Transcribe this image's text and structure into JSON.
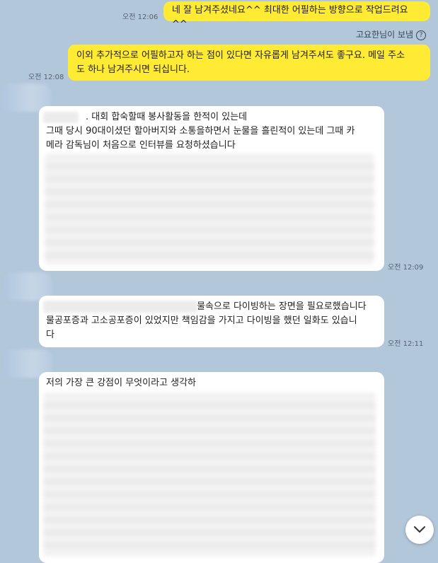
{
  "messages": [
    {
      "sender": "me",
      "time": "오전 12:06",
      "lines": [
        "네 잘 남겨주셨네요^^ 최대한 어필하는 방향으로 작업드려요^^"
      ]
    },
    {
      "sender": "me",
      "time": "오전 12:08",
      "note": "고요한님이 보냄",
      "note_icon": "?",
      "lines": [
        "이외 추가적으로 어필하고자 하는 점이 있다면 자유롭게 남겨주셔도 좋구요. 메일 주소",
        "도 하나 남겨주시면 되십니다."
      ]
    },
    {
      "sender": "other",
      "time": "오전 12:09",
      "lines": [
        ". 대회 합숙할때 봉사활동을 한적이 있는데",
        "그때 당시 90대이셨던 할아버지와 소통을하면서 눈물을 흘린적이 있는데 그때 카",
        "메라 감독님이 처음으로 인터뷰를 요청하셨습니다"
      ]
    },
    {
      "sender": "other",
      "time": "오전 12:11",
      "lines": [
        "물속으로 다이빙하는 장면을 필요로했습니다",
        "물공포증과 고소공포증이 있었지만 책임감을 가지고 다이빙을 했던 일화도 있습니",
        "다"
      ]
    },
    {
      "sender": "other",
      "time": "",
      "lines": [
        "저의 가장 큰 강점이 무엇이라고 생각하"
      ]
    }
  ],
  "scroll_button": {
    "icon": "chevron-down-icon"
  },
  "colors": {
    "background": "#b2c7da",
    "my_bubble": "#ffeb33",
    "other_bubble": "#ffffff"
  }
}
